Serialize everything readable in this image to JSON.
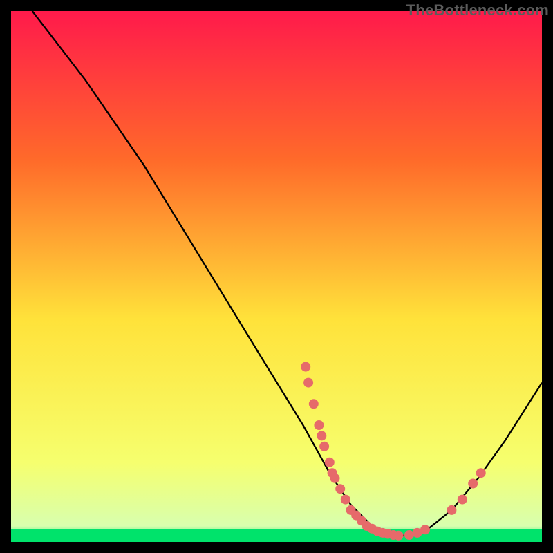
{
  "watermark": "TheBottleneck.com",
  "chart_data": {
    "type": "line",
    "title": "",
    "xlabel": "",
    "ylabel": "",
    "xlim": [
      0,
      100
    ],
    "ylim": [
      0,
      100
    ],
    "background_gradient": {
      "top": "#ff1a4b",
      "mid_high": "#ff7a2a",
      "mid": "#ffe23a",
      "low": "#f6ff6e",
      "band": "#00e36b"
    },
    "curve": [
      {
        "x": 4,
        "y": 100
      },
      {
        "x": 14,
        "y": 87
      },
      {
        "x": 25,
        "y": 71
      },
      {
        "x": 36,
        "y": 53
      },
      {
        "x": 47,
        "y": 35
      },
      {
        "x": 55,
        "y": 22
      },
      {
        "x": 60,
        "y": 13
      },
      {
        "x": 64,
        "y": 7
      },
      {
        "x": 68,
        "y": 3
      },
      {
        "x": 73,
        "y": 1
      },
      {
        "x": 78,
        "y": 2
      },
      {
        "x": 83,
        "y": 6
      },
      {
        "x": 88,
        "y": 12
      },
      {
        "x": 93,
        "y": 19
      },
      {
        "x": 100,
        "y": 30
      }
    ],
    "scatter": [
      {
        "x": 55.5,
        "y": 33
      },
      {
        "x": 56,
        "y": 30
      },
      {
        "x": 57,
        "y": 26
      },
      {
        "x": 58,
        "y": 22
      },
      {
        "x": 58.5,
        "y": 20
      },
      {
        "x": 59,
        "y": 18
      },
      {
        "x": 60,
        "y": 15
      },
      {
        "x": 60.5,
        "y": 13
      },
      {
        "x": 61,
        "y": 12
      },
      {
        "x": 62,
        "y": 10
      },
      {
        "x": 63,
        "y": 8
      },
      {
        "x": 64,
        "y": 6
      },
      {
        "x": 65,
        "y": 5
      },
      {
        "x": 66,
        "y": 4
      },
      {
        "x": 67,
        "y": 3
      },
      {
        "x": 68,
        "y": 2.5
      },
      {
        "x": 69,
        "y": 2
      },
      {
        "x": 70,
        "y": 1.7
      },
      {
        "x": 71,
        "y": 1.5
      },
      {
        "x": 72,
        "y": 1.3
      },
      {
        "x": 73,
        "y": 1.2
      },
      {
        "x": 75,
        "y": 1.3
      },
      {
        "x": 76.5,
        "y": 1.7
      },
      {
        "x": 78,
        "y": 2.3
      },
      {
        "x": 83,
        "y": 6
      },
      {
        "x": 85,
        "y": 8
      },
      {
        "x": 87,
        "y": 11
      },
      {
        "x": 88.5,
        "y": 13
      }
    ],
    "scatter_color": "#e66a6a",
    "curve_color": "#000000"
  }
}
